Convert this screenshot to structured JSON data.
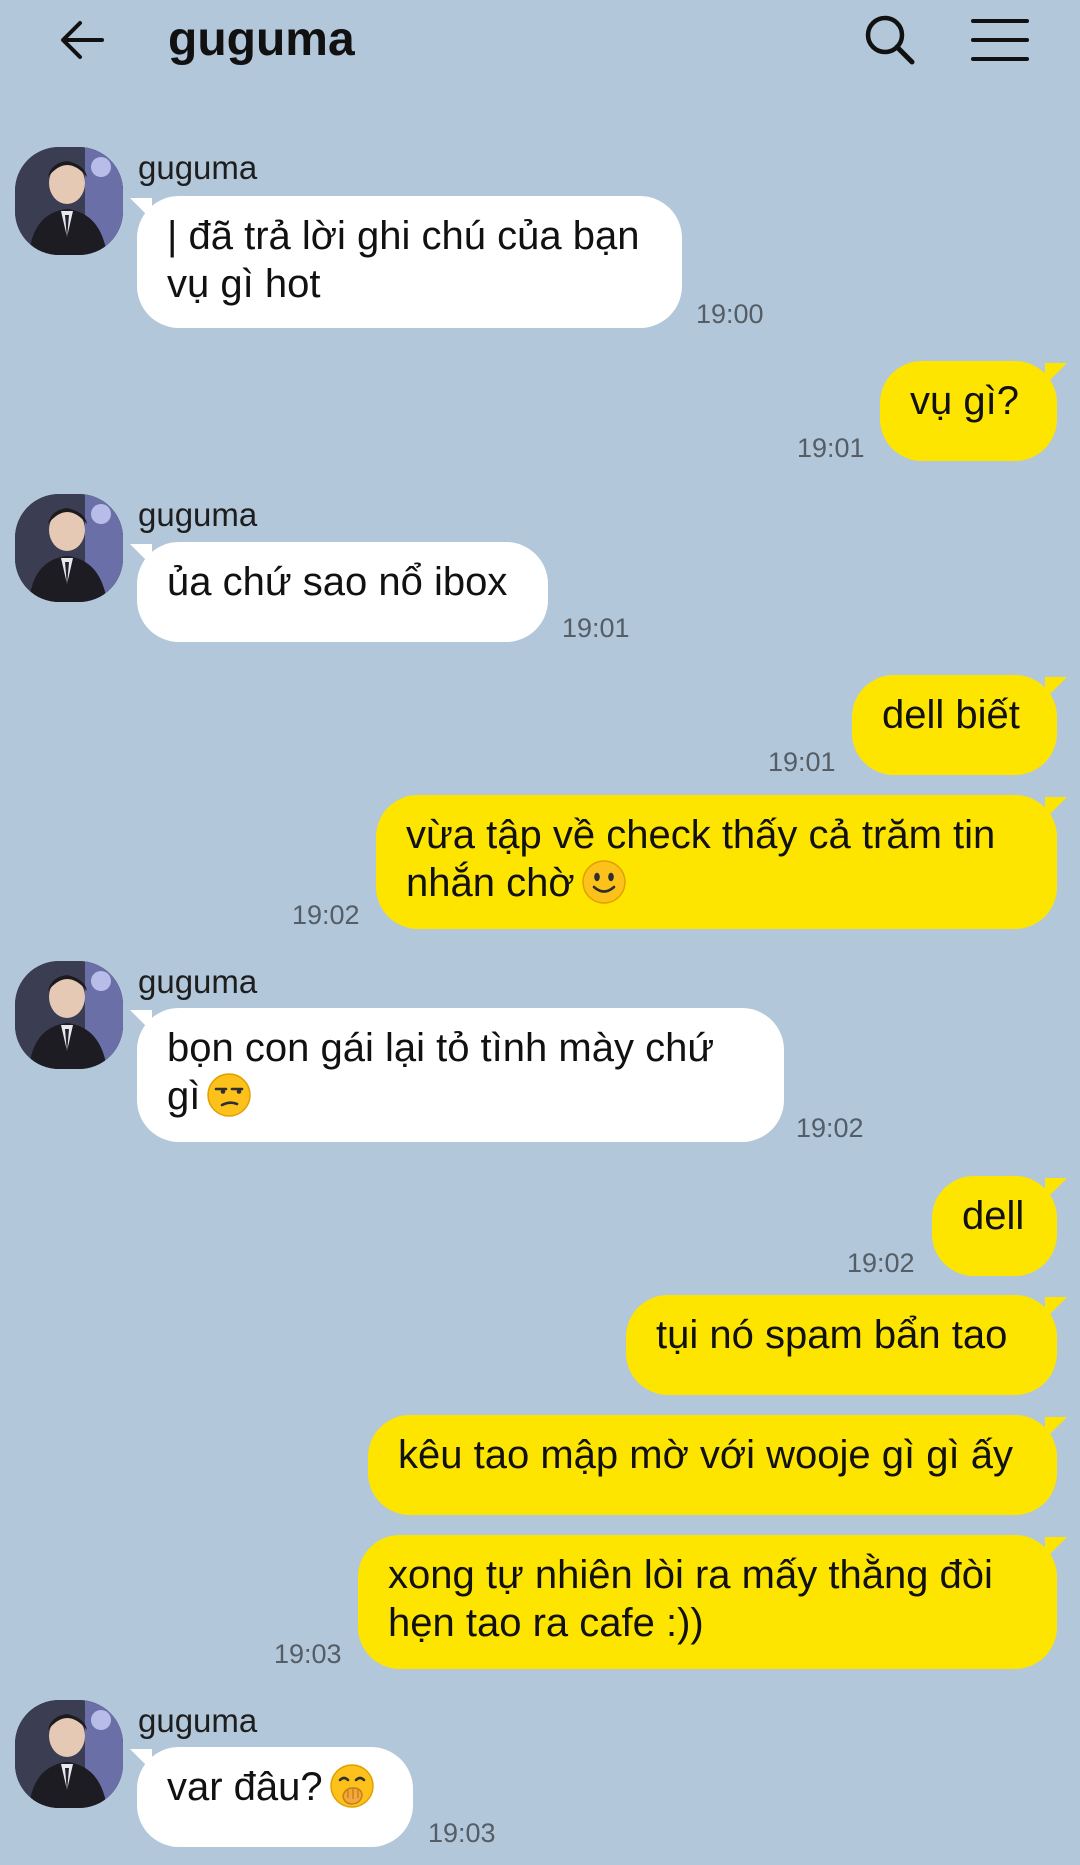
{
  "header": {
    "title": "guguma",
    "back_icon": "back-arrow-icon",
    "search_icon": "search-icon",
    "menu_icon": "hamburger-menu-icon"
  },
  "messages": [
    {
      "side": "in",
      "sender": "guguma",
      "lines": [
        "| đã trả lời ghi chú của bạn",
        "vụ gì hot"
      ],
      "time": "19:00"
    },
    {
      "side": "out",
      "lines": [
        "vụ gì?"
      ],
      "time": "19:01"
    },
    {
      "side": "in",
      "sender": "guguma",
      "lines": [
        "ủa chứ sao nổ ibox"
      ],
      "time": "19:01"
    },
    {
      "side": "out",
      "lines": [
        "dell biết"
      ],
      "time": "19:01"
    },
    {
      "side": "out",
      "lines": [
        "vừa tập về check thấy cả trăm tin",
        "nhắn chờ"
      ],
      "emoji": "slightly-smiling-face",
      "time": "19:02"
    },
    {
      "side": "in",
      "sender": "guguma",
      "lines": [
        "bọn con gái lại tỏ tình mày chứ",
        "gì"
      ],
      "emoji": "unamused-face",
      "time": "19:02"
    },
    {
      "side": "out",
      "lines": [
        "dell"
      ],
      "time": "19:02"
    },
    {
      "side": "out",
      "lines": [
        "tụi nó spam bẩn tao"
      ]
    },
    {
      "side": "out",
      "lines": [
        "kêu tao mập mờ với wooje gì gì ấy"
      ]
    },
    {
      "side": "out",
      "lines": [
        "xong tự nhiên lòi ra mấy thằng đòi",
        "hẹn tao ra cafe :))"
      ],
      "time": "19:03"
    },
    {
      "side": "in",
      "sender": "guguma",
      "lines": [
        "var đâu?"
      ],
      "emoji": "hand-over-mouth-face",
      "time": "19:03"
    }
  ],
  "colors": {
    "background": "#b2c7d9",
    "incoming_bubble": "#ffffff",
    "outgoing_bubble": "#fee500",
    "timestamp": "#555d66"
  }
}
